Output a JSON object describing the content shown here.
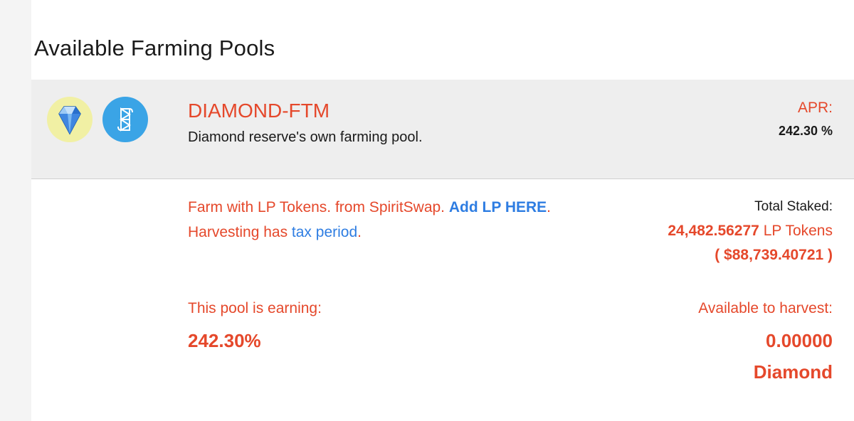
{
  "page": {
    "title": "Available Farming Pools"
  },
  "pool": {
    "name": "DIAMOND-FTM",
    "description": "Diamond reserve's own farming pool.",
    "icons": [
      "diamond-icon",
      "fantom-icon"
    ],
    "apr_label": "APR:",
    "apr_value": "242.30 %",
    "farm_text": "Farm with LP Tokens. from SpiritSwap.",
    "add_lp_link": "Add LP HERE",
    "farm_text_end": ".",
    "harvest_text": "Harvesting has",
    "tax_period_link": "tax period",
    "harvest_text_end": ".",
    "total_staked_label": "Total Staked:",
    "staked_amount": "24,482.56277",
    "staked_unit": "LP Tokens",
    "staked_usd": "( $88,739.40721 )",
    "earning_label": "This pool is earning:",
    "earning_value": "242.30%",
    "available_label": "Available to harvest:",
    "available_amount": "0.00000",
    "available_token": "Diamond"
  },
  "colors": {
    "accent_red": "#e5482b",
    "link_blue": "#2e7de2",
    "header_bg": "#eeeeee",
    "diamond_icon_bg": "#f1f0a4",
    "fantom_icon_bg": "#3aa4e6"
  }
}
